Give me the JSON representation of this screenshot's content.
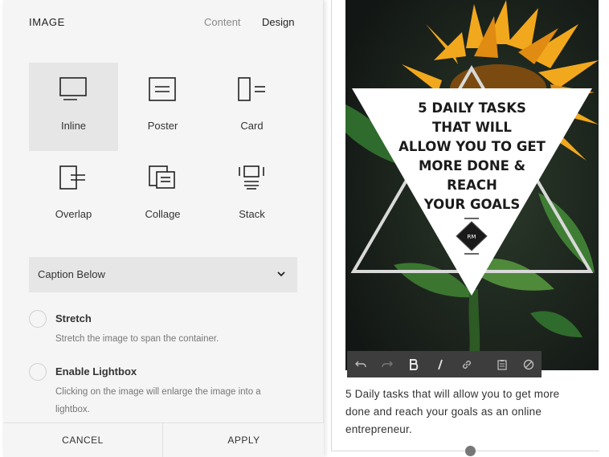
{
  "panel": {
    "title": "IMAGE",
    "tabs": [
      {
        "label": "Content",
        "active": false
      },
      {
        "label": "Design",
        "active": true
      }
    ],
    "layouts": [
      {
        "label": "Inline",
        "icon": "inline-layout-icon",
        "selected": true
      },
      {
        "label": "Poster",
        "icon": "poster-layout-icon",
        "selected": false
      },
      {
        "label": "Card",
        "icon": "card-layout-icon",
        "selected": false
      },
      {
        "label": "Overlap",
        "icon": "overlap-layout-icon",
        "selected": false
      },
      {
        "label": "Collage",
        "icon": "collage-layout-icon",
        "selected": false
      },
      {
        "label": "Stack",
        "icon": "stack-layout-icon",
        "selected": false
      }
    ],
    "caption_select": {
      "value": "Caption Below"
    },
    "options": [
      {
        "label": "Stretch",
        "description": "Stretch the image to span the container.",
        "checked": false
      },
      {
        "label": "Enable Lightbox",
        "description": "Clicking on the image will enlarge the image into a lightbox.",
        "checked": false
      }
    ],
    "footer": {
      "cancel": "CANCEL",
      "apply": "APPLY"
    }
  },
  "image": {
    "poster_lines": [
      "5 DAILY TASKS",
      "THAT WILL",
      "ALLOW YOU TO GET",
      "MORE DONE &",
      "REACH",
      "YOUR GOALS"
    ],
    "logo_text": "RM"
  },
  "toolbar": {
    "buttons": [
      "undo-icon",
      "redo-icon",
      "bold-icon",
      "italic-icon",
      "link-icon",
      "paste-icon",
      "clear-format-icon"
    ]
  },
  "caption": {
    "text": "5 Daily tasks that will allow you to get more done and reach your goals as an online entrepreneur."
  },
  "colors": {
    "panel_bg": "#f5f5f5",
    "selected_tile": "#e6e6e6",
    "toolbar_bg": "#3d3d3d",
    "petal": "#f2a81d"
  }
}
